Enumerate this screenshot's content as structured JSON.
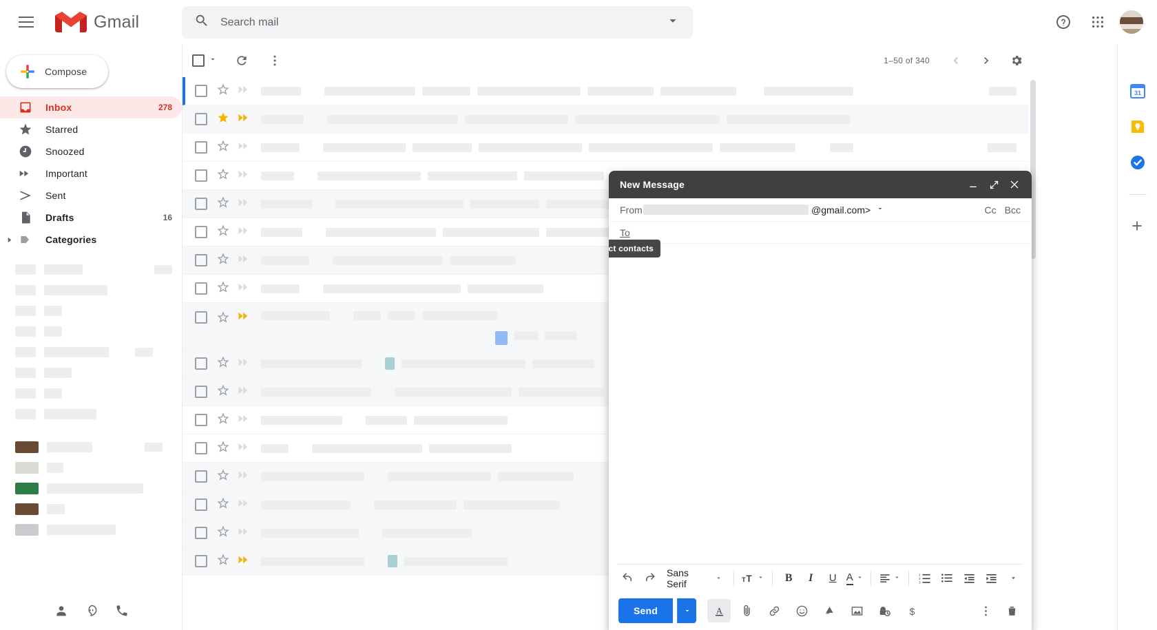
{
  "app": {
    "name": "Gmail",
    "menu_icon": "hamburger-icon",
    "logo_icon": "gmail-m-logo"
  },
  "search": {
    "placeholder": "Search mail",
    "value": "",
    "icon": "search-icon",
    "options_icon": "chevron-down-icon"
  },
  "topbar": {
    "help_icon": "help-icon",
    "apps_icon": "apps-grid-icon",
    "avatar": "user-avatar"
  },
  "sidebar": {
    "compose": {
      "label": "Compose",
      "icon": "plus-icon"
    },
    "items": [
      {
        "label": "Inbox",
        "count": "278",
        "icon": "inbox-icon",
        "active": true
      },
      {
        "label": "Starred",
        "count": "",
        "icon": "star-icon",
        "active": false
      },
      {
        "label": "Snoozed",
        "count": "",
        "icon": "clock-icon",
        "active": false
      },
      {
        "label": "Important",
        "count": "",
        "icon": "important-chevron-icon",
        "active": false
      },
      {
        "label": "Sent",
        "count": "",
        "icon": "send-arrow-icon",
        "active": false
      },
      {
        "label": "Drafts",
        "count": "16",
        "icon": "draft-page-icon",
        "active": false
      },
      {
        "label": "Categories",
        "count": "",
        "icon": "label-tag-icon",
        "active": false
      }
    ],
    "footer_icons": [
      "contacts-icon",
      "hangouts-icon",
      "phone-icon"
    ]
  },
  "list_toolbar": {
    "select_all_icon": "checkbox-icon",
    "select_caret_icon": "chevron-down-icon",
    "refresh_icon": "refresh-icon",
    "more_icon": "more-vertical-icon",
    "pagination": "1–50 of 340",
    "prev_icon": "chevron-left-icon",
    "next_icon": "chevron-right-icon",
    "settings_icon": "gear-icon"
  },
  "right_rail": {
    "items": [
      {
        "name": "google-calendar-icon",
        "label": "31"
      },
      {
        "name": "google-keep-icon",
        "label": ""
      },
      {
        "name": "google-tasks-icon",
        "label": ""
      }
    ],
    "add_icon": "plus-icon"
  },
  "compose": {
    "title": "New Message",
    "minimize_icon": "minimize-icon",
    "expand_icon": "expand-icon",
    "close_icon": "close-icon",
    "from_label": "From",
    "from_value": "@gmail.com>",
    "from_caret_icon": "chevron-down-icon",
    "cc_label": "Cc",
    "bcc_label": "Bcc",
    "to_label": "To",
    "to_value": "",
    "tooltip": "Select contacts",
    "body_value": "",
    "format_toolbar": {
      "undo_icon": "undo-icon",
      "redo_icon": "redo-icon",
      "font_family": "Sans Serif",
      "font_caret_icon": "chevron-down-icon",
      "font_size_icon": "font-size-icon",
      "bold_label": "B",
      "italic_label": "I",
      "underline_label": "U",
      "text_color_label": "A",
      "align_icon": "align-left-icon",
      "numbered_list_icon": "numbered-list-icon",
      "bulleted_list_icon": "bulleted-list-icon",
      "indent_less_icon": "indent-decrease-icon",
      "indent_more_icon": "indent-increase-icon",
      "more_icon": "chevron-down-icon"
    },
    "send": {
      "label": "Send",
      "caret_icon": "chevron-down-icon",
      "format_icon": "format-text-icon",
      "attach_icon": "attachment-icon",
      "link_icon": "link-icon",
      "emoji_icon": "emoji-icon",
      "drive_icon": "google-drive-icon",
      "image_icon": "insert-photo-icon",
      "confidential_icon": "confidential-mode-icon",
      "money_icon": "send-money-icon",
      "more_icon": "more-vertical-icon",
      "discard_icon": "trash-icon"
    }
  },
  "colors": {
    "gmail_red": "#d93025",
    "blue_accent": "#1a73e8",
    "compose_header": "#404040",
    "inbox_highlight": "#fce8e6"
  }
}
